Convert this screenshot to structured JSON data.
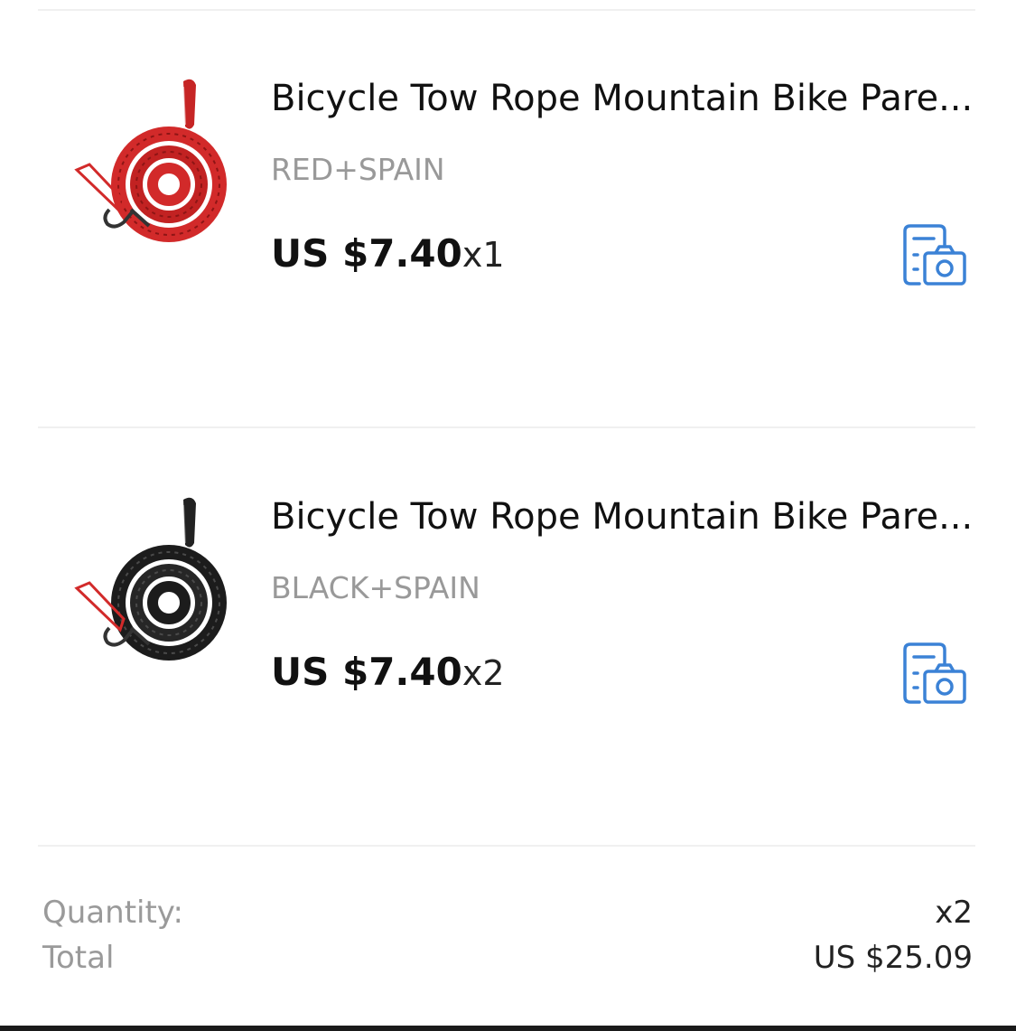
{
  "items": [
    {
      "title": "Bicycle Tow Rope Mountain Bike Pare...",
      "variant": "RED+SPAIN",
      "price": "US $7.40",
      "qty": "x1",
      "image_color": "#d22a2a",
      "action_icon": "photo-review-icon"
    },
    {
      "title": "Bicycle Tow Rope Mountain Bike Pare...",
      "variant": "BLACK+SPAIN",
      "price": "US $7.40",
      "qty": "x2",
      "image_color": "#1c1c1c",
      "action_icon": "photo-review-icon"
    }
  ],
  "summary": {
    "quantity_label": "Quantity:",
    "quantity_value": "x2",
    "total_label": "Total",
    "total_value": "US $25.09"
  },
  "colors": {
    "icon_blue": "#3b82d6",
    "muted_text": "#999999",
    "divider": "#f0f0f0"
  }
}
